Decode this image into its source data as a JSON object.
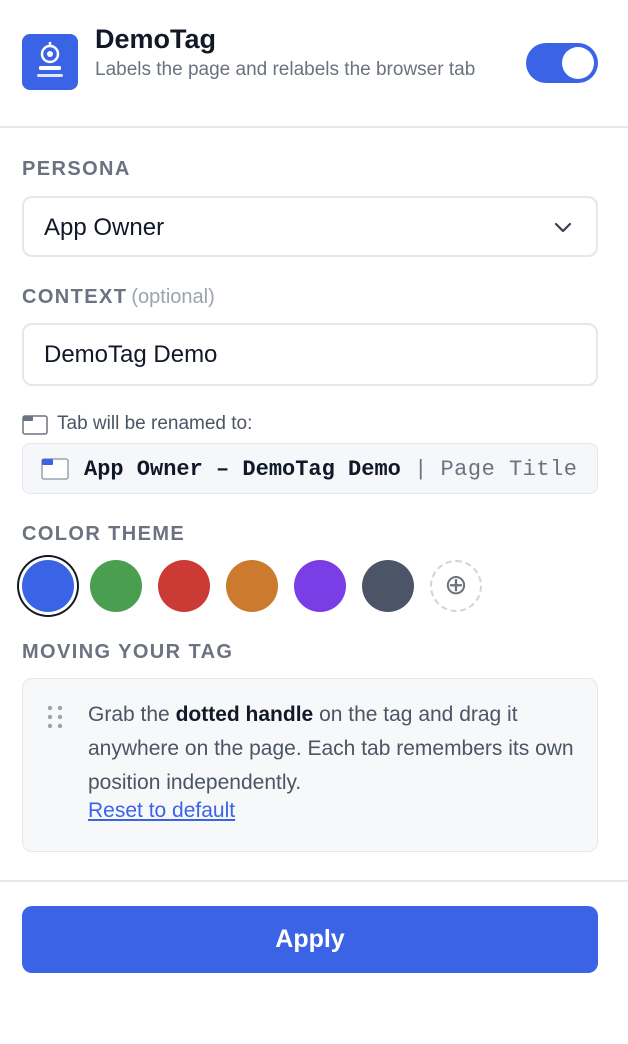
{
  "app": {
    "title": "DemoTag",
    "subtitle": "Labels the page and relabels the browser tab",
    "icon": "robot-tag-icon",
    "enabled": true
  },
  "persona": {
    "label": "PERSONA",
    "value": "App Owner"
  },
  "context": {
    "label": "CONTEXT",
    "optional": "(optional)",
    "value": "DemoTag Demo"
  },
  "tab_preview": {
    "hint": "Tab will be renamed to:",
    "name": "App Owner – DemoTag Demo",
    "separator": "|",
    "page_title": "Page Title"
  },
  "theme": {
    "label": "COLOR THEME",
    "colors": [
      "#3b63e6",
      "#4a9e50",
      "#cc3a35",
      "#cc7a2e",
      "#7b3ee6",
      "#4b5567"
    ],
    "selected_index": 0,
    "add_icon": "plus-circle-icon"
  },
  "moving": {
    "label": "MOVING YOUR TAG",
    "text_before": "Grab the ",
    "text_bold": "dotted handle",
    "text_after": " on the tag and drag it anywhere on the page. Each tab remembers its own position independently.",
    "reset_label": "Reset to default"
  },
  "apply_label": "Apply"
}
